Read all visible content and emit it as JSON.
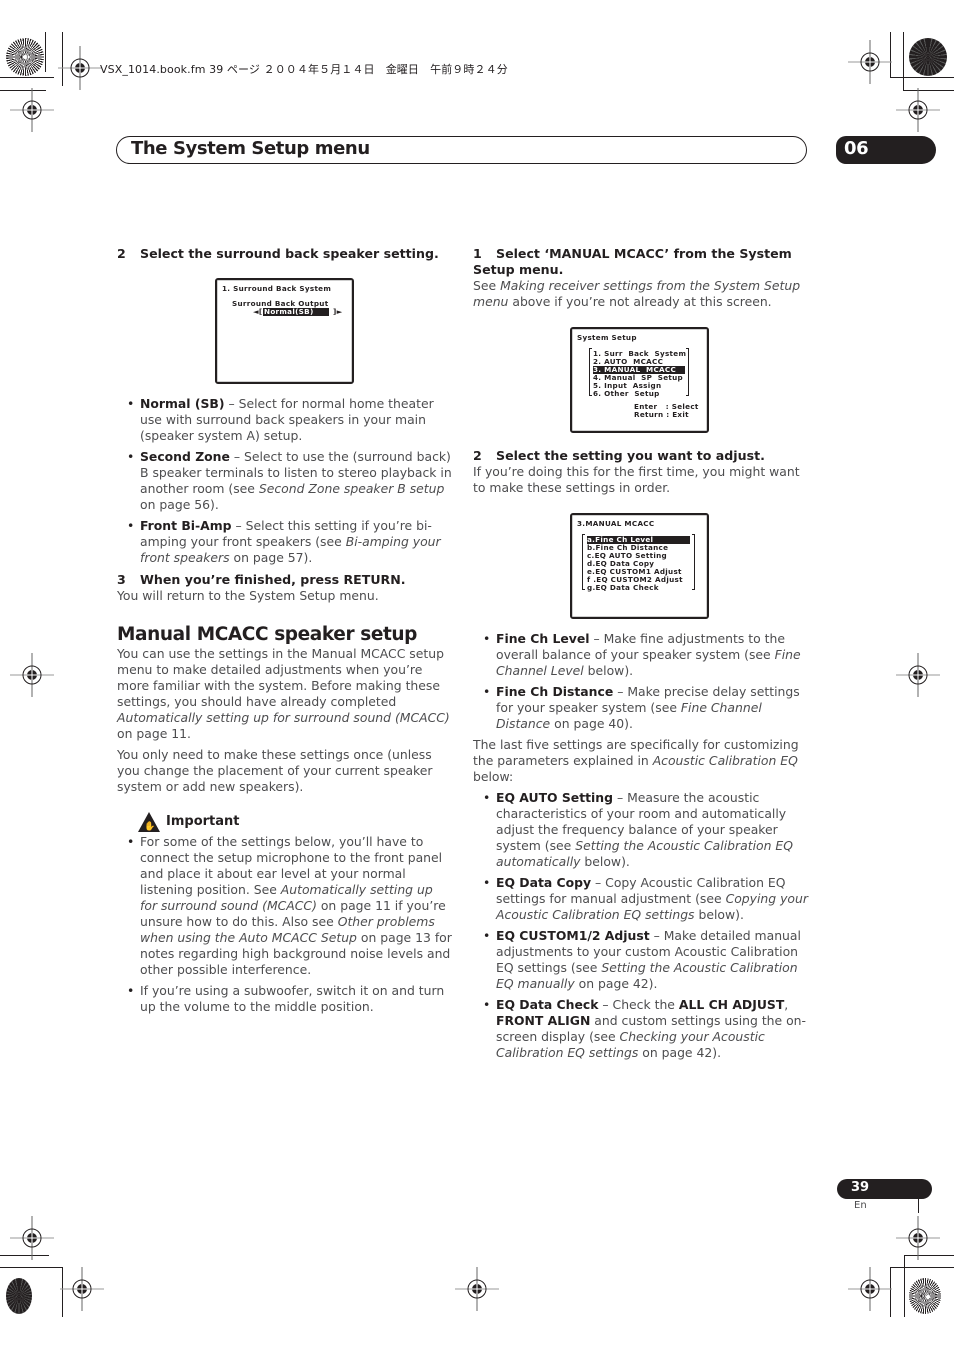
{
  "slug": "VSX_1014.book.fm  39 ページ  ２００４年５月１４日　金曜日　午前９時２４分",
  "header": {
    "title": "The System Setup menu",
    "chapter": "06"
  },
  "left": {
    "step2": {
      "num": "2",
      "text": "Select the surround back speaker setting."
    },
    "osd1": {
      "title": "1. Surround Back System",
      "label": "Surround Back Output",
      "left_arrow": "◄[",
      "value": "Normal(SB)",
      "right_arrow": "]►"
    },
    "bullets": [
      {
        "term": "Normal (SB)",
        "pre": " – Select for normal home theater use with surround back speakers in your main (speaker system A) setup.",
        "ref": "",
        "post": ""
      },
      {
        "term": "Second Zone",
        "pre": " – Select to use the (surround back) B speaker terminals to listen to stereo playback in another room (see ",
        "ref": "Second Zone speaker B setup",
        "post": " on page 56)."
      },
      {
        "term": "Front Bi-Amp",
        "pre": " – Select this setting if you’re bi-amping your front speakers (see ",
        "ref": "Bi-amping your front speakers",
        "post": " on page 57)."
      }
    ],
    "step3": {
      "num": "3",
      "text": "When you’re finished, press RETURN.",
      "body": "You will return to the System Setup menu."
    },
    "section": {
      "heading": "Manual MCACC speaker setup",
      "p1_pre": "You can use the settings in the Manual MCACC setup menu to make detailed adjustments when you’re more familiar with the system. Before making these settings, you should have already completed ",
      "p1_ref": "Automatically setting up for surround sound (MCACC)",
      "p1_post": " on page 11.",
      "p2": "You only need to make these settings once (unless you change the placement of your current speaker system or add new speakers)."
    },
    "important": {
      "icon": "warning-hand-icon",
      "heading": "Important",
      "b1_a": "For some of the settings below, you’ll have to connect the setup microphone to the front panel and place it about ear level at your normal listening position. See ",
      "b1_ref1": "Automatically setting up for surround sound (MCACC)",
      "b1_b": " on page 11 if you’re unsure how to do this. Also see ",
      "b1_ref2": "Other problems when using the Auto MCACC Setup",
      "b1_c": " on page 13 for notes regarding high background noise levels and other possible interference.",
      "b2": "If you’re using a subwoofer, switch it on and turn up the volume to the middle position."
    }
  },
  "right": {
    "step1": {
      "num": "1",
      "text": "Select ‘MANUAL MCACC’ from the System Setup menu.",
      "body_pre": "See ",
      "body_ref": "Making receiver settings from the System Setup menu",
      "body_post": " above if you’re not already at this screen."
    },
    "osd2": {
      "title": "System Setup",
      "items": [
        "1. Surr  Back  System",
        "2. AUTO  MCACC",
        "3. MANUAL  MCACC",
        "4. Manual  SP  Setup",
        "5. Input  Assign",
        "6. Other  Setup"
      ],
      "selected_index": 2,
      "hint1": "Enter   : Select",
      "hint2": "Return : Exit"
    },
    "step2": {
      "num": "2",
      "text": "Select the setting you want to adjust.",
      "body": "If you’re doing this for the first time, you might want to make these settings in order."
    },
    "osd3": {
      "title": "3.MANUAL MCACC",
      "items": [
        "a.Fine Ch Level",
        "b.Fine Ch Distance",
        "c.EQ AUTO Setting",
        "d.EQ Data Copy",
        "e.EQ CUSTOM1 Adjust",
        "f .EQ CUSTOM2 Adjust",
        "g.EQ Data Check"
      ],
      "selected_index": 0
    },
    "bullets1": [
      {
        "term": "Fine Ch Level",
        "pre": " – Make fine adjustments to the overall balance of your speaker system (see ",
        "ref": "Fine Channel Level",
        "post": " below)."
      },
      {
        "term": "Fine Ch Distance",
        "pre": " – Make precise delay settings for your speaker system (see ",
        "ref": "Fine Channel Distance",
        "post": " on page 40)."
      }
    ],
    "para_pre": "The last five settings are specifically for customizing the parameters explained in ",
    "para_ref": "Acoustic Calibration EQ",
    "para_post": " below:",
    "bullets2": [
      {
        "term": "EQ AUTO Setting",
        "pre": " – Measure the acoustic characteristics of your room and automatically adjust the frequency balance of your speaker system (see ",
        "ref": "Setting the Acoustic Calibration EQ automatically",
        "post": " below)."
      },
      {
        "term": "EQ Data Copy",
        "pre": " – Copy Acoustic Calibration EQ settings for manual adjustment (see ",
        "ref": "Copying your Acoustic Calibration EQ settings",
        "post": " below)."
      },
      {
        "term": "EQ CUSTOM1/2 Adjust",
        "pre": " – Make detailed manual adjustments to your custom Acoustic Calibration EQ settings (see ",
        "ref": "Setting the Acoustic Calibration EQ manually",
        "post": " on page 42)."
      }
    ],
    "last_bullet": {
      "term": "EQ Data Check",
      "a": " – Check the ",
      "b1": "ALL CH ADJUST",
      "b": ", ",
      "b2": "FRONT ALIGN",
      "c": " and custom settings using the on-screen display (see ",
      "ref": "Checking your Acoustic Calibration EQ settings",
      "d": " on page 42)."
    }
  },
  "footer": {
    "page": "39",
    "lang": "En"
  }
}
